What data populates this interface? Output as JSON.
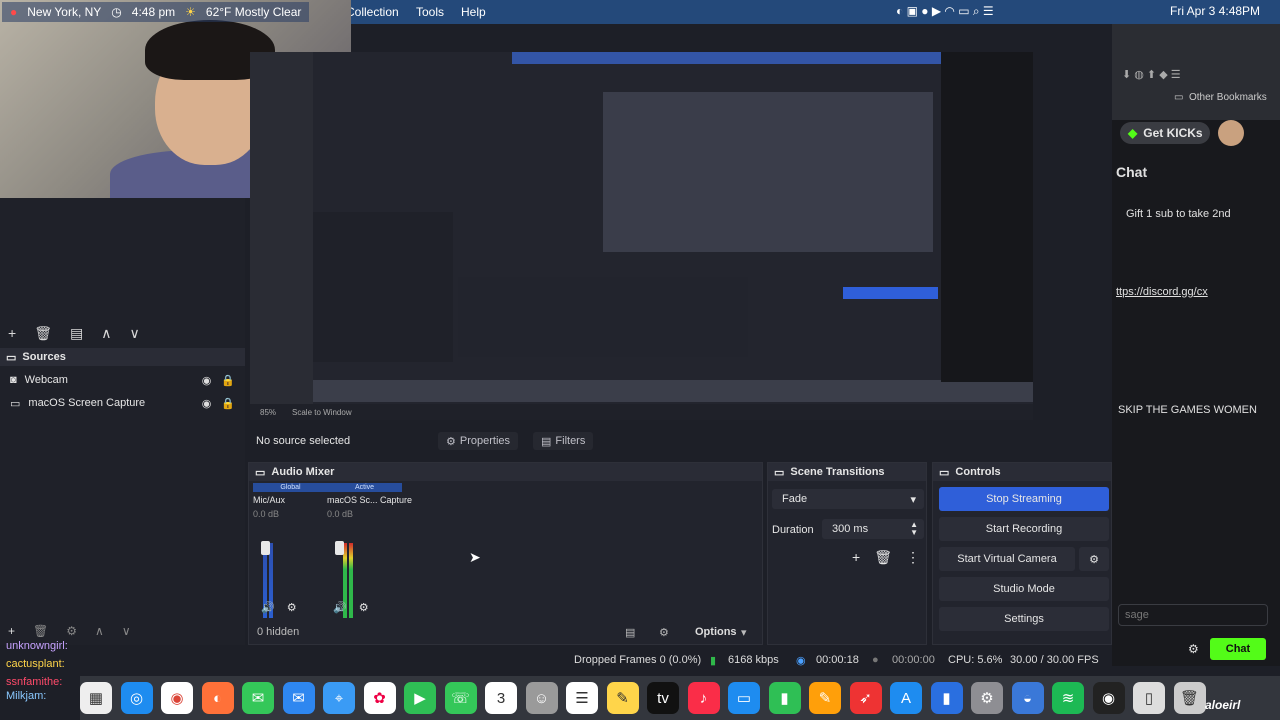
{
  "menubar": {
    "items": [
      "Collection",
      "Tools",
      "Help"
    ],
    "datetime": "Fri Apr 3  4:48PM"
  },
  "stream_overlay": {
    "location": "New York, NY",
    "time": "4:48 pm",
    "weather": "62°F Mostly Clear"
  },
  "sources": {
    "title": "Sources",
    "items": [
      {
        "label": "Webcam",
        "icon": "camera-icon"
      },
      {
        "label": "macOS Screen Capture",
        "icon": "display-icon"
      }
    ]
  },
  "preview_toolbar": {
    "zoom": "85%",
    "scale": "Scale to Window"
  },
  "source_bar": {
    "no_source": "No source selected",
    "properties": "Properties",
    "filters": "Filters"
  },
  "audio_mixer": {
    "title": "Audio Mixer",
    "channels": [
      {
        "tag": "Global",
        "name": "Mic/Aux",
        "db": "0.0 dB"
      },
      {
        "tag": "Active",
        "name": "macOS Sc... Capture",
        "db": "0.0 dB"
      }
    ],
    "hidden": "0 hidden",
    "options": "Options"
  },
  "scene_transitions": {
    "title": "Scene Transitions",
    "transition": "Fade",
    "duration_label": "Duration",
    "duration_value": "300 ms"
  },
  "controls": {
    "title": "Controls",
    "stop_streaming": "Stop Streaming",
    "start_recording": "Start Recording",
    "start_virtual_camera": "Start Virtual Camera",
    "studio_mode": "Studio Mode",
    "settings": "Settings"
  },
  "status": {
    "dropped": "Dropped Frames 0 (0.0%)",
    "bitrate": "6168 kbps",
    "stream_time": "00:00:18",
    "rec_time": "00:00:00",
    "cpu": "CPU: 5.6%",
    "fps": "30.00 / 30.00 FPS"
  },
  "chat_panel": {
    "bookmarks": "Other Bookmarks",
    "get_kicks": "Get KICKs",
    "chat_title": "Chat",
    "gift": "Gift 1 sub to take 2nd",
    "link": "ttps://discord.gg/cx",
    "skip": "SKIP THE GAMES WOMEN",
    "input_placeholder": "sage",
    "chat_button": "Chat"
  },
  "chat_log": [
    {
      "user": "unknowngirl:",
      "msg": ""
    },
    {
      "user": "cactusplant:",
      "msg": ""
    },
    {
      "user": "ssnfamithe:",
      "msg": ""
    },
    {
      "user": "Milkjam:",
      "msg": ""
    }
  ],
  "watermark": "aloeirl",
  "colors": {
    "accent": "#2f5fd9",
    "menubar": "#24497a",
    "panel": "#22242d"
  }
}
